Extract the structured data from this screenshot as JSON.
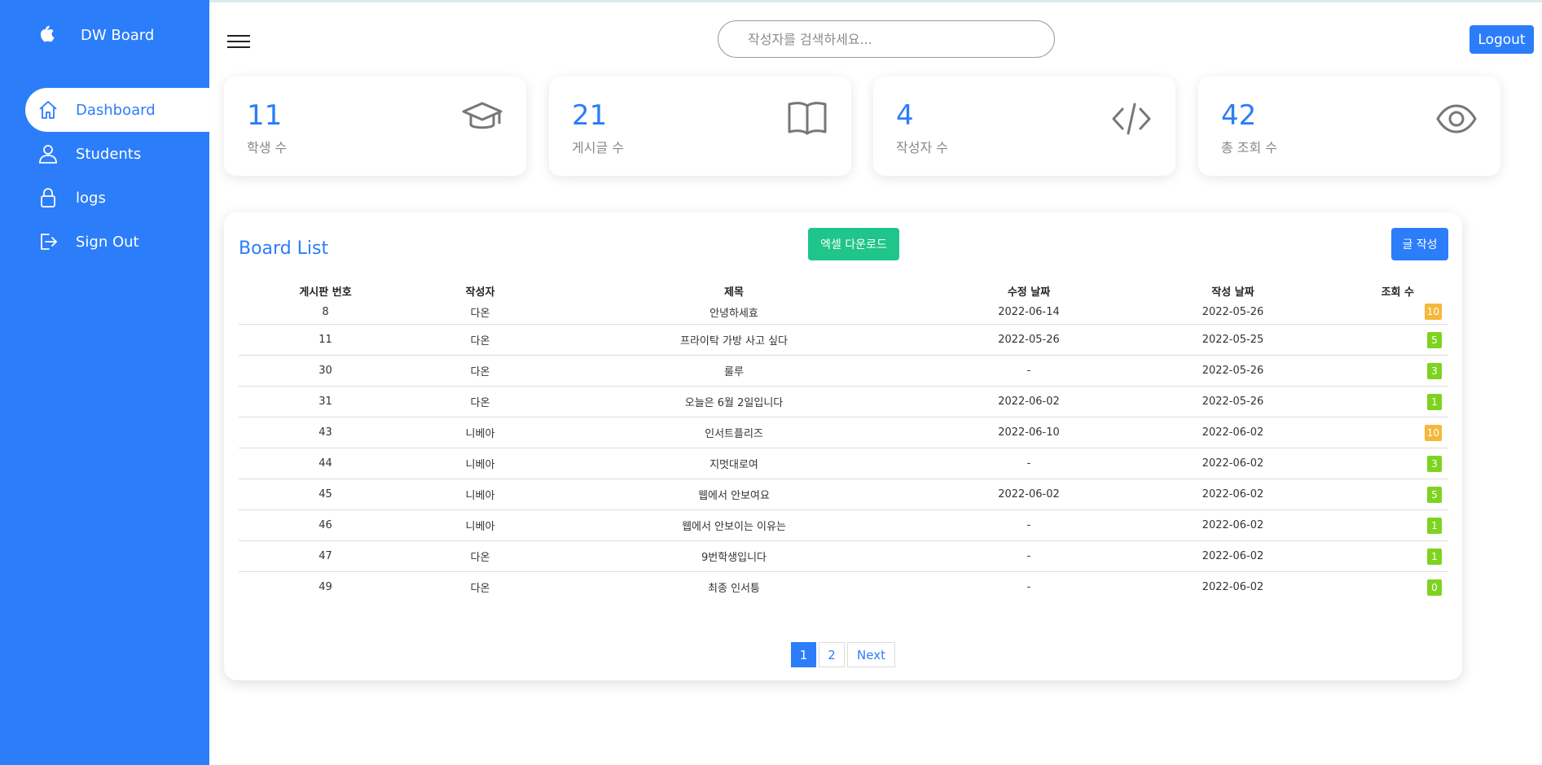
{
  "brand": {
    "name": "DW Board",
    "logo_icon": "apple-icon"
  },
  "sidebar": {
    "items": [
      {
        "label": "Dashboard",
        "icon": "home-icon",
        "active": true
      },
      {
        "label": "Students",
        "icon": "user-icon",
        "active": false
      },
      {
        "label": "logs",
        "icon": "lock-icon",
        "active": false
      },
      {
        "label": "Sign Out",
        "icon": "sign-out-icon",
        "active": false
      }
    ]
  },
  "header": {
    "search_placeholder": "작성자를 검색하세요...",
    "logout_label": "Logout"
  },
  "stats": [
    {
      "value": "11",
      "label": "학생 수",
      "icon": "graduation-cap-icon"
    },
    {
      "value": "21",
      "label": "게시글 수",
      "icon": "book-icon"
    },
    {
      "value": "4",
      "label": "작성자 수",
      "icon": "code-icon"
    },
    {
      "value": "42",
      "label": "총 조회 수",
      "icon": "eye-icon"
    }
  ],
  "board": {
    "title": "Board List",
    "excel_label": "엑셀 다운로드",
    "write_label": "글 작성",
    "columns": [
      "게시판 번호",
      "작성자",
      "제목",
      "수정 날짜",
      "작성 날짜",
      "조회 수"
    ],
    "rows": [
      {
        "no": "8",
        "writer": "다온",
        "title": "안녕하세효",
        "updated": "2022-06-14",
        "created": "2022-05-26",
        "views": "10"
      },
      {
        "no": "11",
        "writer": "다온",
        "title": "프라이탁 가방 사고 싶다",
        "updated": "2022-05-26",
        "created": "2022-05-25",
        "views": "5"
      },
      {
        "no": "30",
        "writer": "다온",
        "title": "룰루",
        "updated": "-",
        "created": "2022-05-26",
        "views": "3"
      },
      {
        "no": "31",
        "writer": "다온",
        "title": "오늘은 6월 2일입니다",
        "updated": "2022-06-02",
        "created": "2022-05-26",
        "views": "1"
      },
      {
        "no": "43",
        "writer": "니베아",
        "title": "인서트플리즈",
        "updated": "2022-06-10",
        "created": "2022-06-02",
        "views": "10"
      },
      {
        "no": "44",
        "writer": "니베아",
        "title": "지멋대로여",
        "updated": "-",
        "created": "2022-06-02",
        "views": "3"
      },
      {
        "no": "45",
        "writer": "니베아",
        "title": "웹에서 안보여요",
        "updated": "2022-06-02",
        "created": "2022-06-02",
        "views": "5"
      },
      {
        "no": "46",
        "writer": "니베아",
        "title": "웹에서 안보이는 이유는",
        "updated": "-",
        "created": "2022-06-02",
        "views": "1"
      },
      {
        "no": "47",
        "writer": "다온",
        "title": "9번학생입니다",
        "updated": "-",
        "created": "2022-06-02",
        "views": "1"
      },
      {
        "no": "49",
        "writer": "다온",
        "title": "최종 인서틍",
        "updated": "-",
        "created": "2022-06-02",
        "views": "0"
      }
    ],
    "pagination": {
      "pages": [
        "1",
        "2"
      ],
      "current": "1",
      "next_label": "Next"
    }
  },
  "colors": {
    "primary": "#2b7dfa",
    "excel_green": "#1fc58b",
    "badge_high": "#f5b83a",
    "badge_low": "#7ed321"
  }
}
